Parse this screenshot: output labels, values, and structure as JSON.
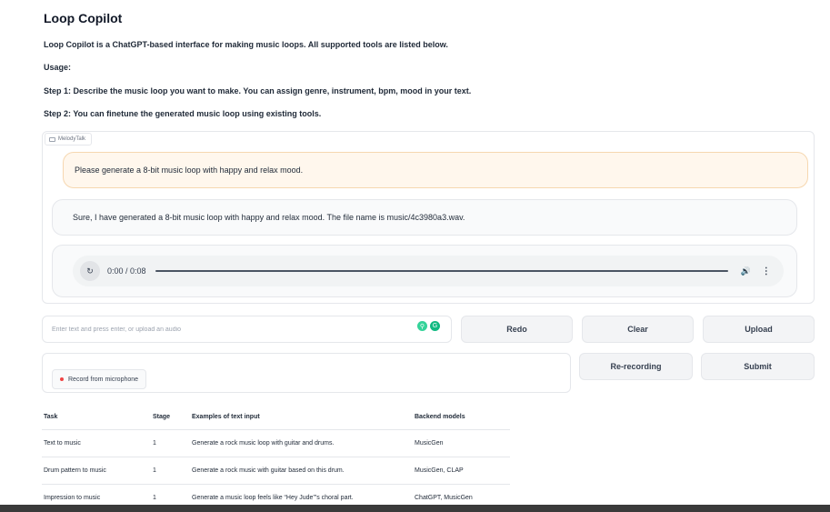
{
  "header": {
    "title": "Loop Copilot",
    "intro": "Loop Copilot is a ChatGPT-based interface for making music loops. All supported tools are listed below.",
    "usage": "Usage:",
    "step1": "Step 1: Describe the music loop you want to make. You can assign genre, instrument, bpm, mood in your text.",
    "step2": "Step 2: You can finetune the generated music loop using existing tools."
  },
  "chat": {
    "label": "MelodyTalk",
    "user_message": "Please generate a 8-bit music loop with happy and relax mood.",
    "bot_message": "Sure, I have generated a 8-bit music loop with happy and relax mood. The file name is music/4c3980a3.wav.",
    "audio": {
      "time": "0:00 / 0:08",
      "progress": 0
    }
  },
  "input": {
    "placeholder": "Enter text and press enter, or upload an audio"
  },
  "buttons": {
    "redo": "Redo",
    "clear": "Clear",
    "upload": "Upload",
    "rerecording": "Re-recording",
    "submit": "Submit",
    "record": "Record from microphone"
  },
  "table": {
    "headers": [
      "Task",
      "Stage",
      "Examples of text input",
      "Backend models"
    ],
    "rows": [
      [
        "Text to music",
        "1",
        "Generate a rock music loop with guitar and drums.",
        "MusicGen"
      ],
      [
        "Drum pattern to music",
        "1",
        "Generate a rock music with guitar based on this drum.",
        "MusicGen, CLAP"
      ],
      [
        "Impression to music",
        "1",
        "Generate a music loop feels like “Hey Jude”’s choral part.",
        "ChatGPT, MusicGen"
      ]
    ]
  },
  "colors": {
    "user_bubble": "#fff7ed",
    "user_border": "#f6d7b0",
    "bot_bubble": "#f9fafb",
    "record_dot": "#ef4444"
  }
}
